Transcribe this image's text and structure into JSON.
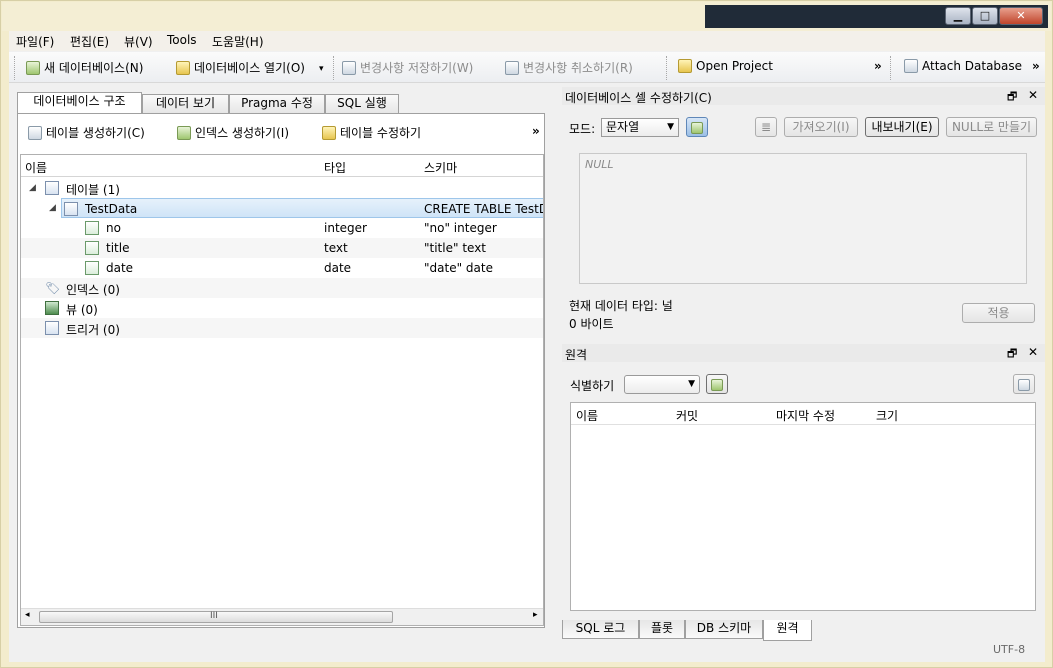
{
  "menus": [
    "파일(F)",
    "편집(E)",
    "뷰(V)",
    "Tools",
    "도움말(H)"
  ],
  "window_controls": {
    "minimize": "▁",
    "maximize": "□",
    "close": "✕"
  },
  "toolbar": {
    "new_db": "새 데이터베이스(N)",
    "open_db": "데이터베이스 열기(O)",
    "write_changes": "변경사항 저장하기(W)",
    "revert_changes": "변경사항 취소하기(R)",
    "open_project": "Open Project",
    "attach_db": "Attach Database",
    "overflow": "»"
  },
  "left_tabs": [
    "데이터베이스 구조",
    "데이터 보기",
    "Pragma 수정",
    "SQL 실행"
  ],
  "structure_toolbar": {
    "create_table": "테이블 생성하기(C)",
    "create_index": "인덱스 생성하기(I)",
    "modify_table": "테이블 수정하기",
    "overflow": "»"
  },
  "tree": {
    "columns": [
      "이름",
      "타입",
      "스키마"
    ],
    "rows": [
      {
        "name": "테이블 (1)",
        "type": "",
        "schema": ""
      },
      {
        "name": "TestData",
        "type": "",
        "schema": "CREATE TABLE TestDat"
      },
      {
        "name": "no",
        "type": "integer",
        "schema": "\"no\" integer"
      },
      {
        "name": "title",
        "type": "text",
        "schema": "\"title\" text"
      },
      {
        "name": "date",
        "type": "date",
        "schema": "\"date\" date"
      },
      {
        "name": "인덱스 (0)",
        "type": "",
        "schema": ""
      },
      {
        "name": "뷰 (0)",
        "type": "",
        "schema": ""
      },
      {
        "name": "트리거 (0)",
        "type": "",
        "schema": ""
      }
    ],
    "scroll_marker": "III"
  },
  "edit_cell": {
    "title": "데이터베이스 셀 수정하기(C)",
    "mode_label": "모드:",
    "mode_value": "문자열",
    "import_btn": "가져오기(I)",
    "export_btn": "내보내기(E)",
    "null_btn": "NULL로 만들기",
    "null_text": "NULL",
    "type_info": "현재 데이터 타입: 널",
    "size_info": "0 바이트",
    "apply_btn": "적용"
  },
  "remote": {
    "title": "원격",
    "identity_label": "식별하기",
    "identity_value": "",
    "columns": [
      "이름",
      "커밋",
      "마지막 수정",
      "크기"
    ]
  },
  "bottom_tabs": [
    "SQL 로그",
    "플롯",
    "DB 스키마",
    "원격"
  ],
  "status": {
    "encoding": "UTF-8"
  },
  "panel_controls": {
    "float": "🗗",
    "close": "✕"
  }
}
